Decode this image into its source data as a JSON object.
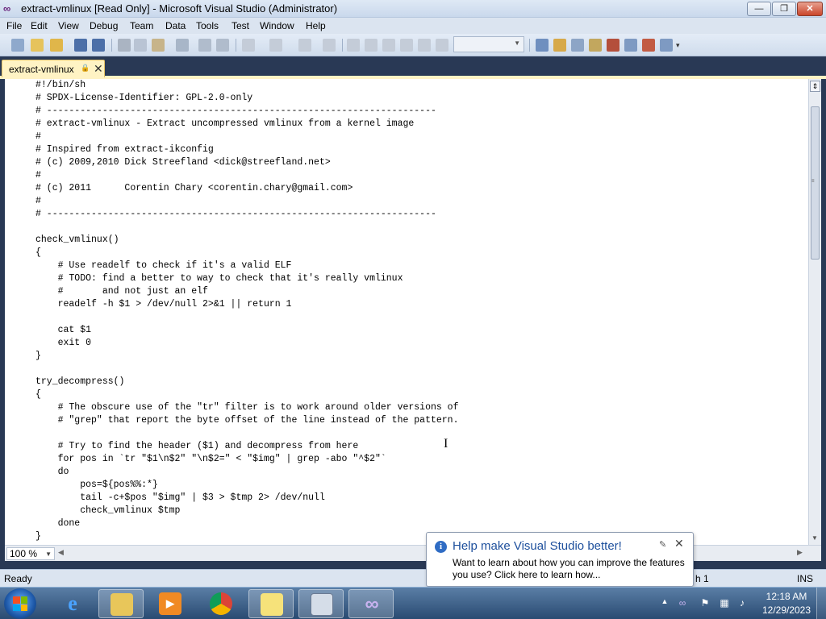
{
  "window": {
    "title": "extract-vmlinux [Read Only] - Microsoft Visual Studio (Administrator)",
    "min_glyph": "—",
    "max_glyph": "❐",
    "close_glyph": "✕"
  },
  "menu": [
    "File",
    "Edit",
    "View",
    "Debug",
    "Team",
    "Data",
    "Tools",
    "Test",
    "Window",
    "Help"
  ],
  "tab": {
    "label": "extract-vmlinux",
    "close_glyph": "✕"
  },
  "code_lines": [
    "#!/bin/sh",
    "# SPDX-License-Identifier: GPL-2.0-only",
    "# ----------------------------------------------------------------------",
    "# extract-vmlinux - Extract uncompressed vmlinux from a kernel image",
    "#",
    "# Inspired from extract-ikconfig",
    "# (c) 2009,2010 Dick Streefland <dick@streefland.net>",
    "#",
    "# (c) 2011      Corentin Chary <corentin.chary@gmail.com>",
    "#",
    "# ----------------------------------------------------------------------",
    "",
    "check_vmlinux()",
    "{",
    "    # Use readelf to check if it's a valid ELF",
    "    # TODO: find a better to way to check that it's really vmlinux",
    "    #       and not just an elf",
    "    readelf -h $1 > /dev/null 2>&1 || return 1",
    "",
    "    cat $1",
    "    exit 0",
    "}",
    "",
    "try_decompress()",
    "{",
    "    # The obscure use of the \"tr\" filter is to work around older versions of",
    "    # \"grep\" that report the byte offset of the line instead of the pattern.",
    "",
    "    # Try to find the header ($1) and decompress from here",
    "    for pos in `tr \"$1\\n$2\" \"\\n$2=\" < \"$img\" | grep -abo \"^$2\"`",
    "    do",
    "        pos=${pos%%:*}",
    "        tail -c+$pos \"$img\" | $3 > $tmp 2> /dev/null",
    "        check_vmlinux $tmp",
    "    done",
    "}"
  ],
  "zoom": "100 %",
  "status": {
    "ready": "Ready",
    "partial": "h 1",
    "ins": "INS"
  },
  "balloon": {
    "title": "Help make Visual Studio better!",
    "body": "Want to learn about how you can improve the features you use? Click here to learn how...",
    "close_glyph": "✕"
  },
  "clock": {
    "time": "12:18 AM",
    "date": "12/29/2023"
  },
  "colors": {
    "vs_purple": "#68217a",
    "tab_yellow": "#fff3c4",
    "chrome_blue": "#293955"
  },
  "icons": [
    "vs-logo-icon",
    "lock-icon",
    "info-icon",
    "pin-icon",
    "windows-start-icon",
    "ie-icon",
    "explorer-folder-icon",
    "media-player-icon",
    "chrome-icon",
    "sticky-notes-icon",
    "keyboard-icon",
    "visual-studio-icon"
  ]
}
